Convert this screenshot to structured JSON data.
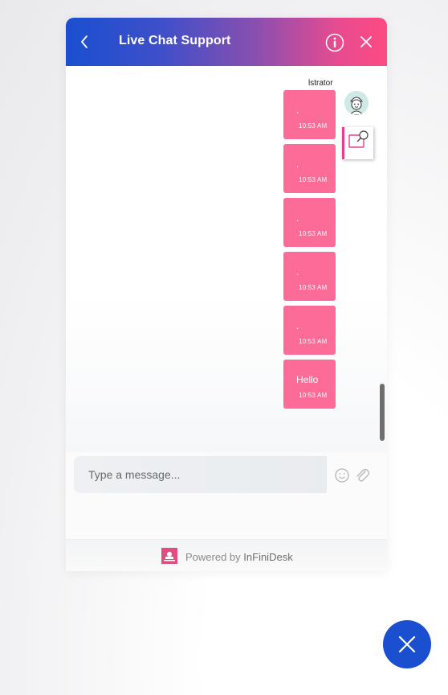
{
  "header": {
    "title": "Live Chat Support",
    "back_icon": "chevron-left-icon",
    "info_icon": "info-icon",
    "close_icon": "close-icon",
    "gradient": [
      "#1a4fd0",
      "#fd4b82"
    ]
  },
  "conversation": {
    "sender_name": "lstrator",
    "avatar_icon": "agent-avatar-icon",
    "snapshot_icon": "screenshot-tool-icon",
    "bubble_color": "#fd6b98",
    "messages": [
      {
        "text": ".",
        "time": "10:53 AM"
      },
      {
        "text": ".",
        "time": "10:53 AM"
      },
      {
        "text": ".",
        "time": "10:53 AM"
      },
      {
        "text": ".",
        "time": "10:53 AM"
      },
      {
        "text": ".",
        "time": "10:53 AM"
      },
      {
        "text": "Hello",
        "time": "10:53 AM"
      }
    ]
  },
  "composer": {
    "placeholder": "Type a message...",
    "value": "",
    "emoji_icon": "emoji-icon",
    "attach_icon": "paperclip-icon"
  },
  "footer": {
    "powered_prefix": "Powered by",
    "brand": "InFiniDesk",
    "logo_icon": "infinidesk-logo-icon"
  },
  "launcher": {
    "icon": "close-icon",
    "color": "#1a4fd0"
  }
}
